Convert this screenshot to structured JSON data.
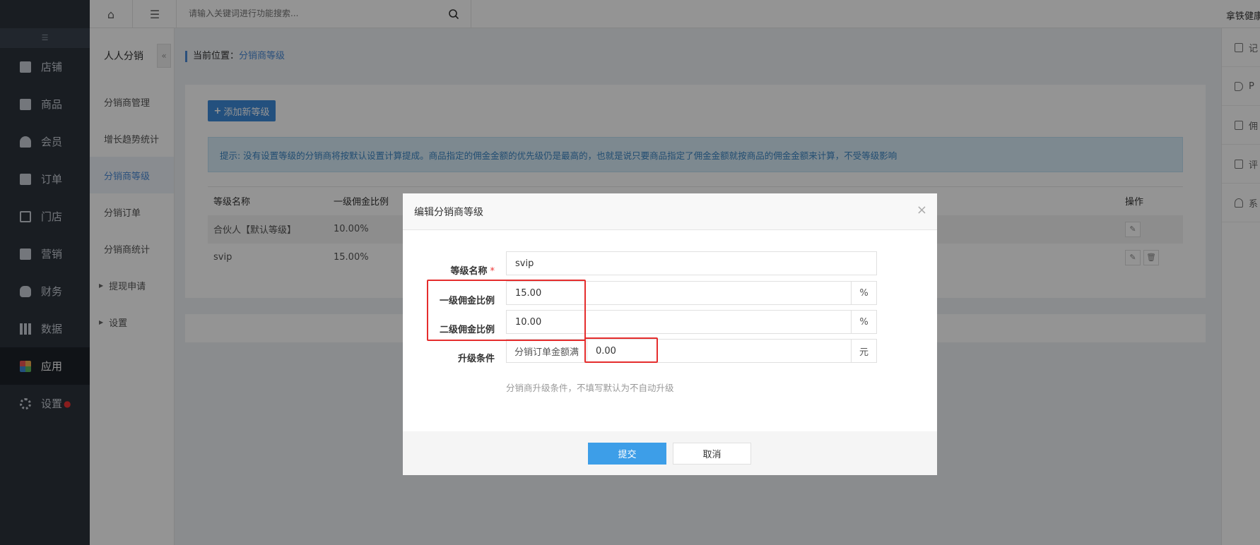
{
  "nav": {
    "items": [
      {
        "label": "店铺",
        "icon": "store-icon"
      },
      {
        "label": "商品",
        "icon": "goods-icon"
      },
      {
        "label": "会员",
        "icon": "user-icon"
      },
      {
        "label": "订单",
        "icon": "order-icon"
      },
      {
        "label": "门店",
        "icon": "shop-icon"
      },
      {
        "label": "营销",
        "icon": "gift-icon"
      },
      {
        "label": "财务",
        "icon": "money-bag-icon"
      },
      {
        "label": "数据",
        "icon": "bar-chart-icon"
      },
      {
        "label": "应用",
        "icon": "apps-icon"
      },
      {
        "label": "设置",
        "icon": "gear-icon"
      }
    ],
    "active_index": 8
  },
  "topbar": {
    "search_placeholder": "请输入关键词进行功能搜索...",
    "user_name": "拿铁健康"
  },
  "subnav": {
    "title": "人人分销",
    "items": [
      "分销商管理",
      "增长趋势统计",
      "分销商等级",
      "分销订单",
      "分销商统计"
    ],
    "groups": [
      "提现申请",
      "设置"
    ],
    "active_index": 2
  },
  "right_panel": {
    "items": [
      "记",
      "P",
      "佣",
      "评",
      "系"
    ]
  },
  "breadcrumb": {
    "prefix": "当前位置：",
    "current": "分销商等级"
  },
  "main": {
    "add_button": "添加新等级",
    "tip": "提示: 没有设置等级的分销商将按默认设置计算提成。商品指定的佣金金额的优先级仍是最高的，也就是说只要商品指定了佣金金额就按商品的佣金金额来计算，不受等级影响",
    "table": {
      "headers": [
        "等级名称",
        "一级佣金比例",
        "操作"
      ],
      "rows": [
        {
          "name": "合伙人【默认等级】",
          "rate": "10.00%"
        },
        {
          "name": "svip",
          "rate": "15.00%"
        }
      ]
    }
  },
  "modal": {
    "title": "编辑分销商等级",
    "fields": {
      "name_label": "等级名称",
      "name_required": "*",
      "name_value": "svip",
      "level1_label": "一级佣金比例",
      "level1_value": "15.00",
      "level2_label": "二级佣金比例",
      "level2_value": "10.00",
      "percent": "%",
      "upgrade_label": "升级条件",
      "upgrade_prefix": "分销订单金额满",
      "upgrade_value": "0.00",
      "upgrade_unit": "元",
      "upgrade_help": "分销商升级条件，不填写默认为不自动升级"
    },
    "submit": "提交",
    "cancel": "取消"
  }
}
